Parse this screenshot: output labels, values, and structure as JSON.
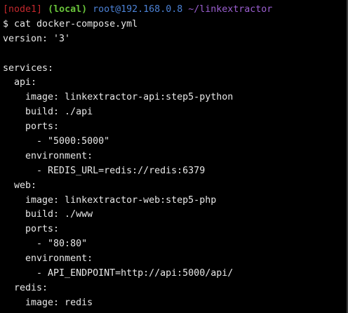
{
  "prompt": {
    "node": "[node1]",
    "env": "(local)",
    "host": "root@192.168.0.8",
    "path": "~/linkextractor"
  },
  "command": {
    "symbol": "$",
    "text": "cat docker-compose.yml"
  },
  "file_lines": [
    "version: '3'",
    "",
    "services:",
    "  api:",
    "    image: linkextractor-api:step5-python",
    "    build: ./api",
    "    ports:",
    "      - \"5000:5000\"",
    "    environment:",
    "      - REDIS_URL=redis://redis:6379",
    "  web:",
    "    image: linkextractor-web:step5-php",
    "    build: ./www",
    "    ports:",
    "      - \"80:80\"",
    "    environment:",
    "      - API_ENDPOINT=http://api:5000/api/",
    "  redis:",
    "    image: redis"
  ],
  "colors": {
    "background": "#000000",
    "node": "#c2282d",
    "env": "#69c43a",
    "host": "#4c82d6",
    "path": "#9b5fd0",
    "text": "#e8e8e8"
  }
}
